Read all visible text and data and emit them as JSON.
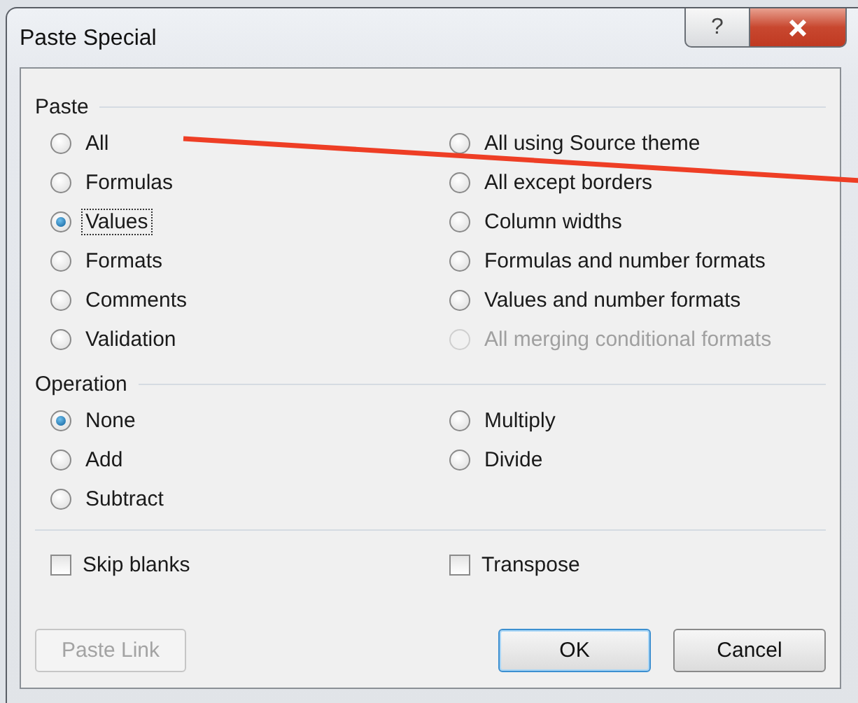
{
  "window": {
    "title": "Paste Special",
    "help_button": {
      "label": "?"
    }
  },
  "paste": {
    "label": "Paste",
    "options": [
      {
        "label": "All",
        "selected": false,
        "disabled": false,
        "focused": false
      },
      {
        "label": "All using Source theme",
        "selected": false,
        "disabled": false,
        "focused": false
      },
      {
        "label": "Formulas",
        "selected": false,
        "disabled": false,
        "focused": false
      },
      {
        "label": "All except borders",
        "selected": false,
        "disabled": false,
        "focused": false
      },
      {
        "label": "Values",
        "selected": true,
        "disabled": false,
        "focused": true
      },
      {
        "label": "Column widths",
        "selected": false,
        "disabled": false,
        "focused": false
      },
      {
        "label": "Formats",
        "selected": false,
        "disabled": false,
        "focused": false
      },
      {
        "label": "Formulas and number formats",
        "selected": false,
        "disabled": false,
        "focused": false
      },
      {
        "label": "Comments",
        "selected": false,
        "disabled": false,
        "focused": false
      },
      {
        "label": "Values and number formats",
        "selected": false,
        "disabled": false,
        "focused": false
      },
      {
        "label": "Validation",
        "selected": false,
        "disabled": false,
        "focused": false
      },
      {
        "label": "All merging conditional formats",
        "selected": false,
        "disabled": true,
        "focused": false
      }
    ]
  },
  "operation": {
    "label": "Operation",
    "options": [
      {
        "label": "None",
        "selected": true,
        "disabled": false,
        "focused": false
      },
      {
        "label": "Multiply",
        "selected": false,
        "disabled": false,
        "focused": false
      },
      {
        "label": "Add",
        "selected": false,
        "disabled": false,
        "focused": false
      },
      {
        "label": "Divide",
        "selected": false,
        "disabled": false,
        "focused": false
      },
      {
        "label": "Subtract",
        "selected": false,
        "disabled": false,
        "focused": false
      }
    ]
  },
  "checkboxes": [
    {
      "label": "Skip blanks",
      "checked": false
    },
    {
      "label": "Transpose",
      "checked": false
    }
  ],
  "buttons": [
    {
      "label": "Paste Link",
      "disabled": true,
      "default": false
    },
    {
      "label": "OK",
      "disabled": false,
      "default": true
    },
    {
      "label": "Cancel",
      "disabled": false,
      "default": false
    }
  ]
}
